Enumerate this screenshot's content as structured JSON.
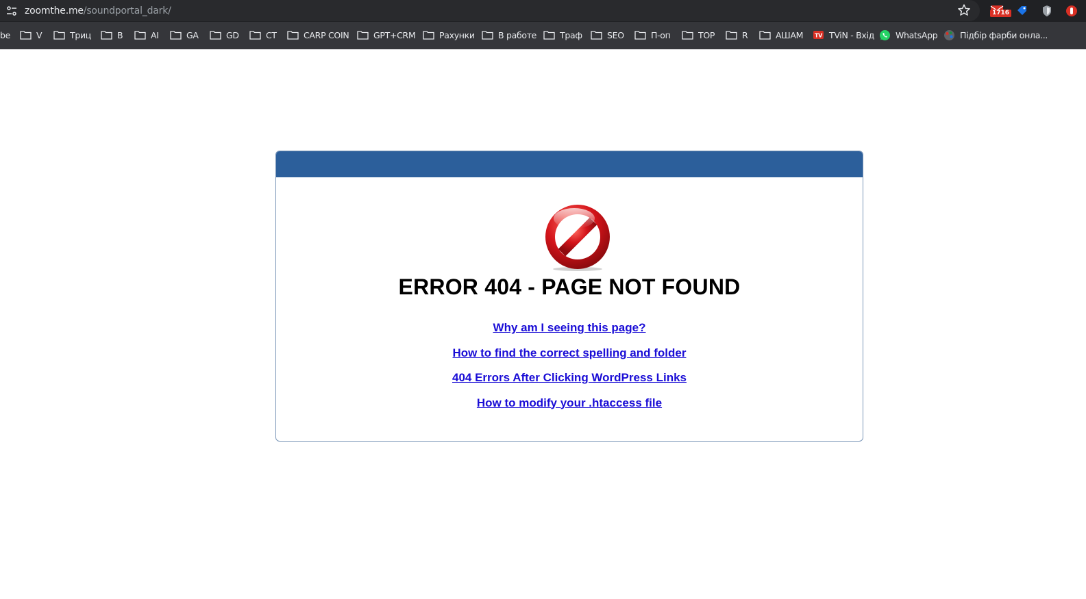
{
  "browser": {
    "url_host": "zoomthe.me",
    "url_path": "/soundportal_dark/",
    "extension_badge": "1716",
    "bookmarks": [
      {
        "label": "be",
        "icon": "none"
      },
      {
        "label": "V",
        "icon": "folder-icon"
      },
      {
        "label": "Триц",
        "icon": "folder-icon"
      },
      {
        "label": "B",
        "icon": "folder-icon"
      },
      {
        "label": "AI",
        "icon": "folder-icon"
      },
      {
        "label": "GA",
        "icon": "folder-icon"
      },
      {
        "label": "GD",
        "icon": "folder-icon"
      },
      {
        "label": "CT",
        "icon": "folder-icon"
      },
      {
        "label": "CARP COIN",
        "icon": "folder-icon"
      },
      {
        "label": "GPT+CRM",
        "icon": "folder-icon"
      },
      {
        "label": "Рахунки",
        "icon": "folder-icon"
      },
      {
        "label": "В работе",
        "icon": "folder-icon"
      },
      {
        "label": "Траф",
        "icon": "folder-icon"
      },
      {
        "label": "SEO",
        "icon": "folder-icon"
      },
      {
        "label": "П-оп",
        "icon": "folder-icon"
      },
      {
        "label": "TOP",
        "icon": "folder-icon"
      },
      {
        "label": "R",
        "icon": "folder-icon"
      },
      {
        "label": "АШАМ",
        "icon": "folder-icon"
      },
      {
        "label": "TViN - Вхід",
        "icon": "tvin-icon"
      },
      {
        "label": "WhatsApp",
        "icon": "whatsapp-icon"
      },
      {
        "label": "Підбір фарби онла...",
        "icon": "palette-icon"
      }
    ]
  },
  "page": {
    "title": "ERROR 404 - PAGE NOT FOUND",
    "links": [
      "Why am I seeing this page?",
      "How to find the correct spelling and folder",
      "404 Errors After Clicking WordPress Links",
      "How to modify your .htaccess file"
    ]
  },
  "colors": {
    "card_header": "#2c5f9b",
    "link": "#1a0dd6",
    "stop_red": "#d4141a"
  }
}
